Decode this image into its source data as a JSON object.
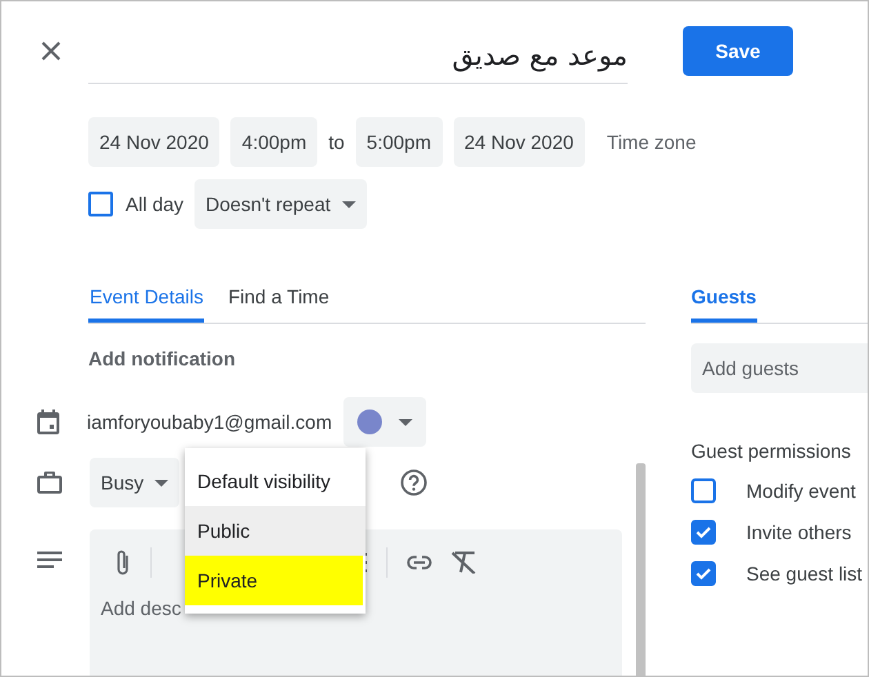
{
  "title": "موعد مع صديق",
  "save_button": "Save",
  "schedule": {
    "start_date": "24 Nov 2020",
    "start_time": "4:00pm",
    "separator": "to",
    "end_time": "5:00pm",
    "end_date": "24 Nov 2020",
    "time_zone": "Time zone"
  },
  "all_day": {
    "label": "All day",
    "checked": false
  },
  "repeat": "Doesn't repeat",
  "tabs": [
    {
      "label": "Event Details",
      "selected": true
    },
    {
      "label": "Find a Time",
      "selected": false
    }
  ],
  "add_notification": "Add notification",
  "calendar": {
    "account": "iamforyoubaby1@gmail.com",
    "color": "#7986cb"
  },
  "availability": "Busy",
  "visibility_menu": [
    {
      "label": "Default visibility",
      "hovered": false,
      "highlighted": false
    },
    {
      "label": "Public",
      "hovered": true,
      "highlighted": false
    },
    {
      "label": "Private",
      "hovered": false,
      "highlighted": true
    }
  ],
  "description": {
    "placeholder": "Add desc"
  },
  "guests": {
    "tab": "Guests",
    "tab_selected": true,
    "placeholder": "Add guests",
    "permissions_title": "Guest permissions",
    "permissions": [
      {
        "label": "Modify event",
        "checked": false
      },
      {
        "label": "Invite others",
        "checked": true
      },
      {
        "label": "See guest list",
        "checked": true
      }
    ]
  }
}
